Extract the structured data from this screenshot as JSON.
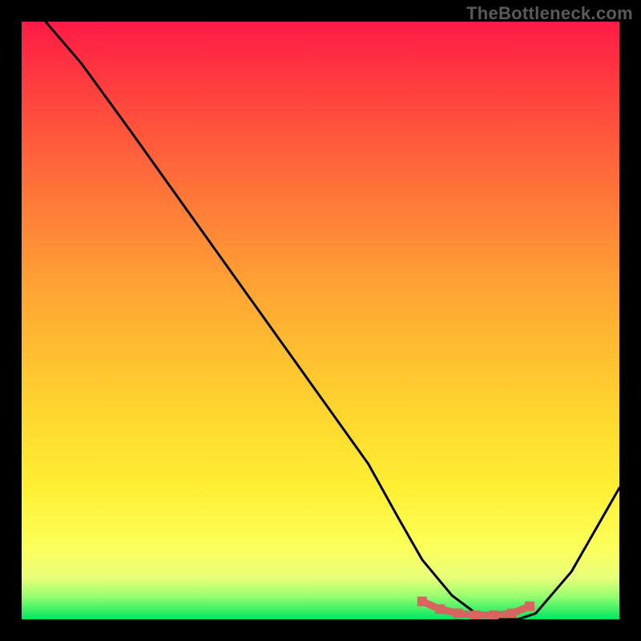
{
  "watermark": "TheBottleneck.com",
  "chart_data": {
    "type": "line",
    "title": "",
    "xlabel": "",
    "ylabel": "",
    "xlim": [
      0,
      100
    ],
    "ylim": [
      0,
      100
    ],
    "series": [
      {
        "name": "bottleneck-curve",
        "x": [
          4,
          10,
          18,
          28,
          38,
          48,
          58,
          63,
          67,
          72,
          76,
          80,
          83,
          86,
          92,
          100
        ],
        "y": [
          100,
          93,
          82,
          68,
          54,
          40,
          26,
          17,
          10,
          4,
          1,
          0,
          0,
          1,
          8,
          22
        ]
      },
      {
        "name": "optimal-range-marker",
        "x": [
          67,
          70,
          73,
          76,
          79,
          82,
          85
        ],
        "y": [
          3.0,
          1.7,
          1.0,
          0.7,
          0.7,
          1.0,
          2.2
        ]
      }
    ],
    "colors": {
      "curve": "#000000",
      "marker": "#d9645f",
      "gradient_top": "#ff1a46",
      "gradient_bottom": "#00e763"
    }
  }
}
